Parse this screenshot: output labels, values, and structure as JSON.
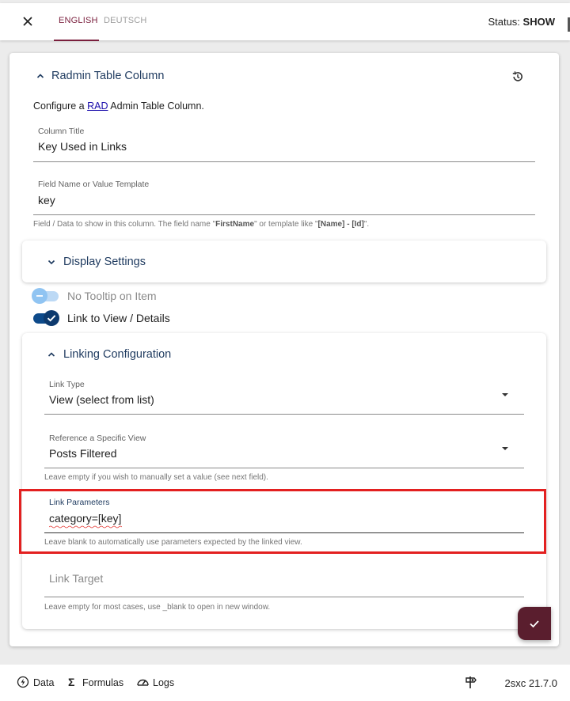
{
  "header": {
    "tabs": [
      {
        "label": "ENGLISH",
        "active": true
      },
      {
        "label": "DEUTSCH",
        "active": false
      }
    ],
    "status_prefix": "Status:",
    "status_value": "SHOW"
  },
  "section": {
    "title": "Radmin Table Column",
    "intro_before": "Configure a ",
    "intro_link": "RAD",
    "intro_after": " Admin Table Column."
  },
  "fields": {
    "column_title": {
      "label": "Column Title",
      "value": "Key Used in Links"
    },
    "field_name": {
      "label": "Field Name or Value Template",
      "value": "key",
      "hint_1": "Field / Data to show in this column. The field name \"",
      "hint_b1": "FirstName",
      "hint_2": "\" or template like \"",
      "hint_b2": "[Name] - [Id]",
      "hint_3": "\"."
    }
  },
  "display_settings": {
    "title": "Display Settings"
  },
  "toggles": {
    "no_tooltip": {
      "label": "No Tooltip on Item",
      "on": false
    },
    "link_to_view": {
      "label": "Link to View / Details",
      "on": true
    }
  },
  "linking": {
    "title": "Linking Configuration",
    "link_type": {
      "label": "Link Type",
      "value": "View (select from list)"
    },
    "specific_view": {
      "label": "Reference a Specific View",
      "value": "Posts Filtered",
      "hint": "Leave empty if you wish to manually set a value (see next field)."
    },
    "link_parameters": {
      "label": "Link Parameters",
      "value": "category=[key]",
      "hint": "Leave blank to automatically use parameters expected by the linked view."
    },
    "link_target": {
      "placeholder": "Link Target",
      "hint": "Leave empty for most cases, use _blank to open in new window."
    }
  },
  "footer": {
    "data": "Data",
    "formulas": "Formulas",
    "logs": "Logs",
    "version": "2sxc 21.7.0"
  },
  "colors": {
    "accent": "#7a1f3d",
    "title_blue": "#1e3a5f",
    "toggle_on": "#0d4a8a",
    "highlight": "#e32020",
    "fab": "#5a1e2e"
  }
}
